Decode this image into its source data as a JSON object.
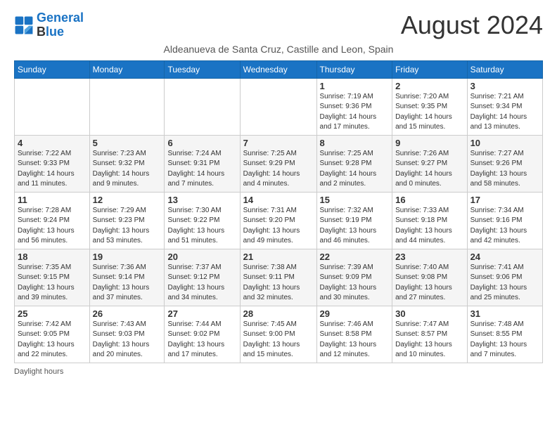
{
  "logo": {
    "line1": "General",
    "line2": "Blue"
  },
  "title": "August 2024",
  "subtitle": "Aldeanueva de Santa Cruz, Castille and Leon, Spain",
  "days_of_week": [
    "Sunday",
    "Monday",
    "Tuesday",
    "Wednesday",
    "Thursday",
    "Friday",
    "Saturday"
  ],
  "weeks": [
    [
      {
        "day": "",
        "info": ""
      },
      {
        "day": "",
        "info": ""
      },
      {
        "day": "",
        "info": ""
      },
      {
        "day": "",
        "info": ""
      },
      {
        "day": "1",
        "info": "Sunrise: 7:19 AM\nSunset: 9:36 PM\nDaylight: 14 hours and 17 minutes."
      },
      {
        "day": "2",
        "info": "Sunrise: 7:20 AM\nSunset: 9:35 PM\nDaylight: 14 hours and 15 minutes."
      },
      {
        "day": "3",
        "info": "Sunrise: 7:21 AM\nSunset: 9:34 PM\nDaylight: 14 hours and 13 minutes."
      }
    ],
    [
      {
        "day": "4",
        "info": "Sunrise: 7:22 AM\nSunset: 9:33 PM\nDaylight: 14 hours and 11 minutes."
      },
      {
        "day": "5",
        "info": "Sunrise: 7:23 AM\nSunset: 9:32 PM\nDaylight: 14 hours and 9 minutes."
      },
      {
        "day": "6",
        "info": "Sunrise: 7:24 AM\nSunset: 9:31 PM\nDaylight: 14 hours and 7 minutes."
      },
      {
        "day": "7",
        "info": "Sunrise: 7:25 AM\nSunset: 9:29 PM\nDaylight: 14 hours and 4 minutes."
      },
      {
        "day": "8",
        "info": "Sunrise: 7:25 AM\nSunset: 9:28 PM\nDaylight: 14 hours and 2 minutes."
      },
      {
        "day": "9",
        "info": "Sunrise: 7:26 AM\nSunset: 9:27 PM\nDaylight: 14 hours and 0 minutes."
      },
      {
        "day": "10",
        "info": "Sunrise: 7:27 AM\nSunset: 9:26 PM\nDaylight: 13 hours and 58 minutes."
      }
    ],
    [
      {
        "day": "11",
        "info": "Sunrise: 7:28 AM\nSunset: 9:24 PM\nDaylight: 13 hours and 56 minutes."
      },
      {
        "day": "12",
        "info": "Sunrise: 7:29 AM\nSunset: 9:23 PM\nDaylight: 13 hours and 53 minutes."
      },
      {
        "day": "13",
        "info": "Sunrise: 7:30 AM\nSunset: 9:22 PM\nDaylight: 13 hours and 51 minutes."
      },
      {
        "day": "14",
        "info": "Sunrise: 7:31 AM\nSunset: 9:20 PM\nDaylight: 13 hours and 49 minutes."
      },
      {
        "day": "15",
        "info": "Sunrise: 7:32 AM\nSunset: 9:19 PM\nDaylight: 13 hours and 46 minutes."
      },
      {
        "day": "16",
        "info": "Sunrise: 7:33 AM\nSunset: 9:18 PM\nDaylight: 13 hours and 44 minutes."
      },
      {
        "day": "17",
        "info": "Sunrise: 7:34 AM\nSunset: 9:16 PM\nDaylight: 13 hours and 42 minutes."
      }
    ],
    [
      {
        "day": "18",
        "info": "Sunrise: 7:35 AM\nSunset: 9:15 PM\nDaylight: 13 hours and 39 minutes."
      },
      {
        "day": "19",
        "info": "Sunrise: 7:36 AM\nSunset: 9:14 PM\nDaylight: 13 hours and 37 minutes."
      },
      {
        "day": "20",
        "info": "Sunrise: 7:37 AM\nSunset: 9:12 PM\nDaylight: 13 hours and 34 minutes."
      },
      {
        "day": "21",
        "info": "Sunrise: 7:38 AM\nSunset: 9:11 PM\nDaylight: 13 hours and 32 minutes."
      },
      {
        "day": "22",
        "info": "Sunrise: 7:39 AM\nSunset: 9:09 PM\nDaylight: 13 hours and 30 minutes."
      },
      {
        "day": "23",
        "info": "Sunrise: 7:40 AM\nSunset: 9:08 PM\nDaylight: 13 hours and 27 minutes."
      },
      {
        "day": "24",
        "info": "Sunrise: 7:41 AM\nSunset: 9:06 PM\nDaylight: 13 hours and 25 minutes."
      }
    ],
    [
      {
        "day": "25",
        "info": "Sunrise: 7:42 AM\nSunset: 9:05 PM\nDaylight: 13 hours and 22 minutes."
      },
      {
        "day": "26",
        "info": "Sunrise: 7:43 AM\nSunset: 9:03 PM\nDaylight: 13 hours and 20 minutes."
      },
      {
        "day": "27",
        "info": "Sunrise: 7:44 AM\nSunset: 9:02 PM\nDaylight: 13 hours and 17 minutes."
      },
      {
        "day": "28",
        "info": "Sunrise: 7:45 AM\nSunset: 9:00 PM\nDaylight: 13 hours and 15 minutes."
      },
      {
        "day": "29",
        "info": "Sunrise: 7:46 AM\nSunset: 8:58 PM\nDaylight: 13 hours and 12 minutes."
      },
      {
        "day": "30",
        "info": "Sunrise: 7:47 AM\nSunset: 8:57 PM\nDaylight: 13 hours and 10 minutes."
      },
      {
        "day": "31",
        "info": "Sunrise: 7:48 AM\nSunset: 8:55 PM\nDaylight: 13 hours and 7 minutes."
      }
    ]
  ],
  "footer": "Daylight hours"
}
